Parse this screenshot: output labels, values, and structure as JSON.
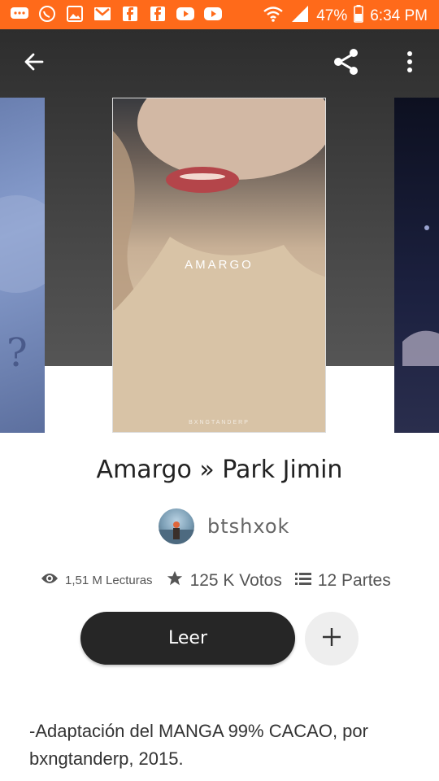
{
  "status_bar": {
    "battery": "47%",
    "time": "6:34 PM"
  },
  "icons": {
    "back": "arrow-left-icon",
    "share": "share-icon",
    "more": "more-vertical-icon",
    "views": "eye-icon",
    "votes": "star-icon",
    "parts": "list-icon",
    "add": "plus-icon"
  },
  "cover": {
    "title": "AMARGO",
    "credit": "BXNGTANDERP"
  },
  "story": {
    "title": "Amargo » Park Jimin",
    "author": "btshxok"
  },
  "stats": {
    "reads": "1,51 M Lecturas",
    "votes": "125 K Votos",
    "parts": "12 Partes"
  },
  "actions": {
    "read_label": "Leer"
  },
  "description": {
    "line1": "-Adaptación del MANGA 99% CACAO, por",
    "line2": "bxngtanderp, 2015."
  },
  "colors": {
    "status_bar": "#ff6a1a",
    "read_button": "#262626",
    "add_button": "#eeeeee"
  }
}
